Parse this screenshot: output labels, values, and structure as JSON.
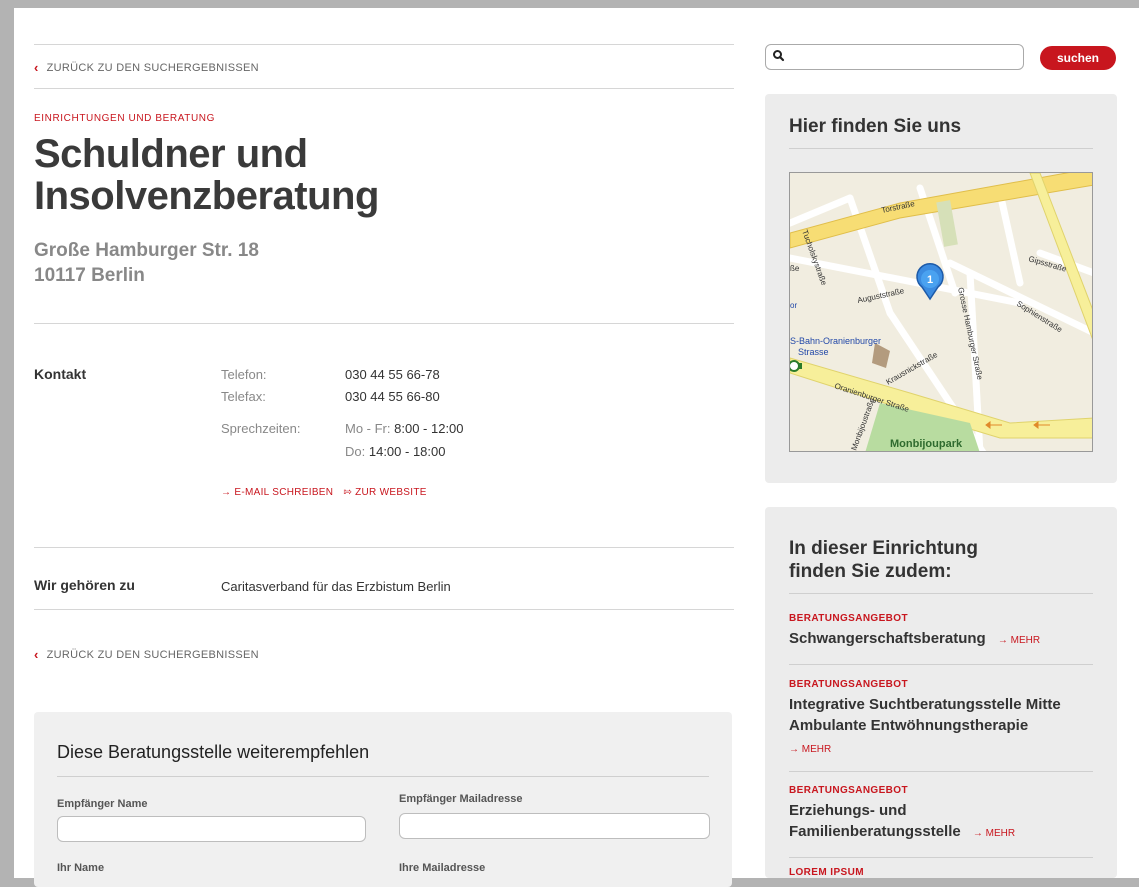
{
  "nav": {
    "back_label": "ZURÜCK ZU DEN SUCHERGEBNISSEN"
  },
  "entry": {
    "category": "EINRICHTUNGEN UND BERATUNG",
    "title_line1": "Schuldner und",
    "title_line2": "Insolvenzberatung",
    "street": "Große Hamburger Str. 18",
    "city": "10117 Berlin"
  },
  "contact": {
    "heading": "Kontakt",
    "phone_label": "Telefon:",
    "phone": "030 44 55 66-78",
    "fax_label": "Telefax:",
    "fax": "030 44 55 66-80",
    "hours_label": "Sprechzeiten:",
    "hours1_days": "Mo - Fr:",
    "hours1_time": "8:00 - 12:00",
    "hours2_days": "Do:",
    "hours2_time": "14:00 - 18:00",
    "email_link": "E-MAIL SCHREIBEN",
    "website_link": "ZUR WEBSITE"
  },
  "membership": {
    "heading": "Wir gehören zu",
    "value": "Caritasverband für das Erzbistum Berlin"
  },
  "recommend": {
    "title": "Diese Beratungsstelle weiterempfehlen",
    "recipient_name_label": "Empfänger Name",
    "recipient_mail_label": "Empfänger Mailadresse",
    "your_name_label": "Ihr Name",
    "your_mail_label": "Ihre Mailadresse",
    "recipient_name_value": "",
    "recipient_mail_value": ""
  },
  "search": {
    "placeholder": "",
    "button_label": "suchen"
  },
  "location": {
    "heading": "Hier finden Sie uns",
    "map_labels": {
      "torstrasse": "Torstraße",
      "tucholsky": "Tucholskystraße",
      "auguststrasse": "Auguststraße",
      "gipsstrasse": "Gipsstraße",
      "sophienstrasse": "Sophienstraße",
      "grosse_hamburger": "Grosse Hamburger Straße",
      "station1": "S-Bahn-Oranienburger",
      "station2": "Strasse",
      "krausnick": "Krausnickstraße",
      "oranienburger": "Oranienburger Straße",
      "monbijoustr": "Monbijoustraße",
      "monbijoupark": "Monbijoupark",
      "left_cut1": "ße",
      "left_cut2": "or",
      "pin": "1"
    }
  },
  "also_here": {
    "heading_line1": "In dieser Einrichtung",
    "heading_line2": "finden Sie zudem:",
    "more_label": "MEHR",
    "items": [
      {
        "category": "BERATUNGSANGEBOT",
        "title": "Schwangerschaftsberatung"
      },
      {
        "category": "BERATUNGSANGEBOT",
        "title_line1": "Integrative Suchtberatungsstelle Mitte",
        "title_line2": "Ambulante Entwöhnungstherapie"
      },
      {
        "category": "BERATUNGSANGEBOT",
        "title_line1": "Erziehungs- und",
        "title_line2": "Familienberatungsstelle"
      },
      {
        "category": "LOREM IPSUM"
      }
    ]
  },
  "colors": {
    "accent": "#c8161e",
    "sidebar_bg": "#ececec",
    "frame": "#b3b3b3"
  }
}
